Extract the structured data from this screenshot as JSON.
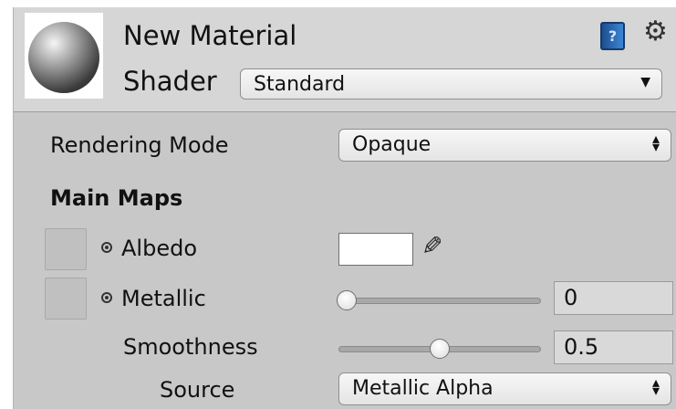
{
  "header": {
    "material_name": "New Material",
    "shader_label": "Shader",
    "shader_value": "Standard",
    "help_icon": "book-help-icon",
    "settings_icon": "gear-icon"
  },
  "rendering": {
    "label": "Rendering Mode",
    "value": "Opaque"
  },
  "main_maps": {
    "heading": "Main Maps",
    "albedo": {
      "label": "Albedo",
      "color": "#ffffff"
    },
    "metallic": {
      "label": "Metallic",
      "value": "0",
      "slider_fraction": 0.0
    },
    "smoothness": {
      "label": "Smoothness",
      "value": "0.5",
      "slider_fraction": 0.5
    },
    "source": {
      "label": "Source",
      "value": "Metallic Alpha"
    }
  }
}
